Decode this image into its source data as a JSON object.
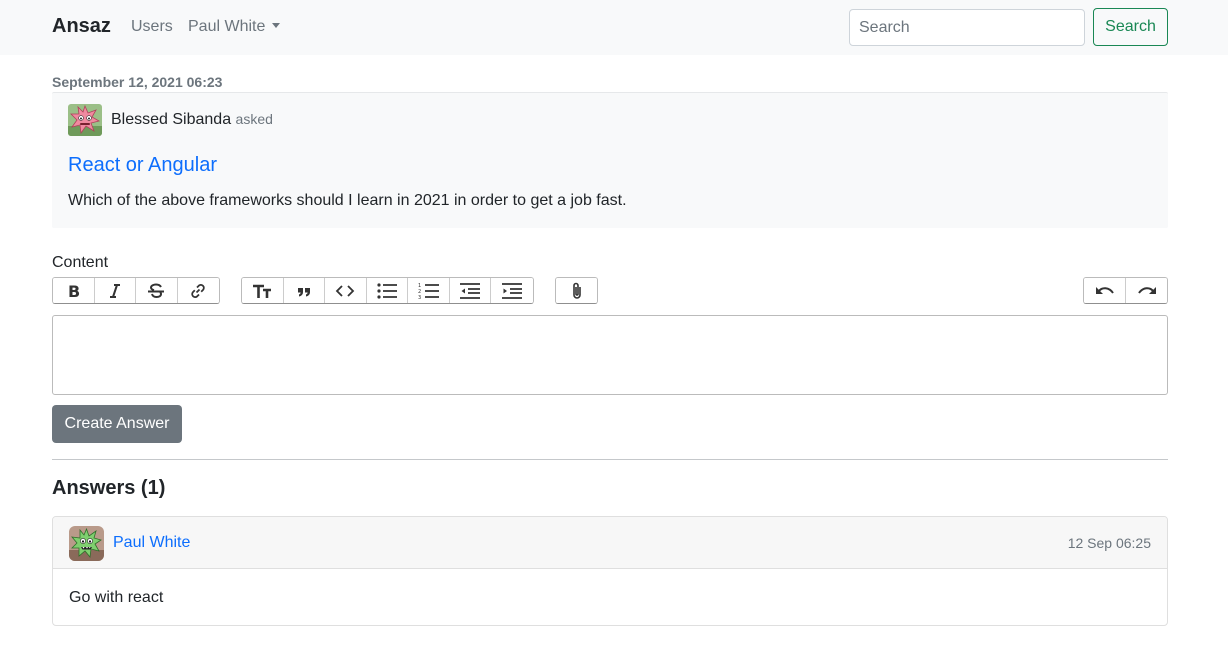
{
  "navbar": {
    "brand": "Ansaz",
    "users_link": "Users",
    "user_menu": "Paul White",
    "search_placeholder": "Search",
    "search_button": "Search"
  },
  "question": {
    "date": "September 12, 2021 06:23",
    "author": "Blessed Sibanda",
    "asked_label": "asked",
    "title": "React or Angular",
    "body": "Which of the above frameworks should I learn in 2021 in order to get a job fast."
  },
  "editor": {
    "label": "Content",
    "toolbar_groups": [
      [
        "bold-icon",
        "italic-icon",
        "strikethrough-icon",
        "link-icon"
      ],
      [
        "heading-icon",
        "quote-icon",
        "code-icon",
        "bullet-list-icon",
        "numbered-list-icon",
        "decrease-indent-icon",
        "increase-indent-icon"
      ],
      [
        "attach-file-icon"
      ],
      [
        "undo-icon",
        "redo-icon"
      ]
    ],
    "submit_button": "Create Answer"
  },
  "answers": {
    "heading": "Answers (1)",
    "items": [
      {
        "author": "Paul White",
        "time": "12 Sep 06:25",
        "body": "Go with react"
      }
    ]
  },
  "colors": {
    "link": "#0d6efd",
    "success": "#198754",
    "secondary": "#6c757d",
    "navbar_bg": "#f8f9fa"
  }
}
